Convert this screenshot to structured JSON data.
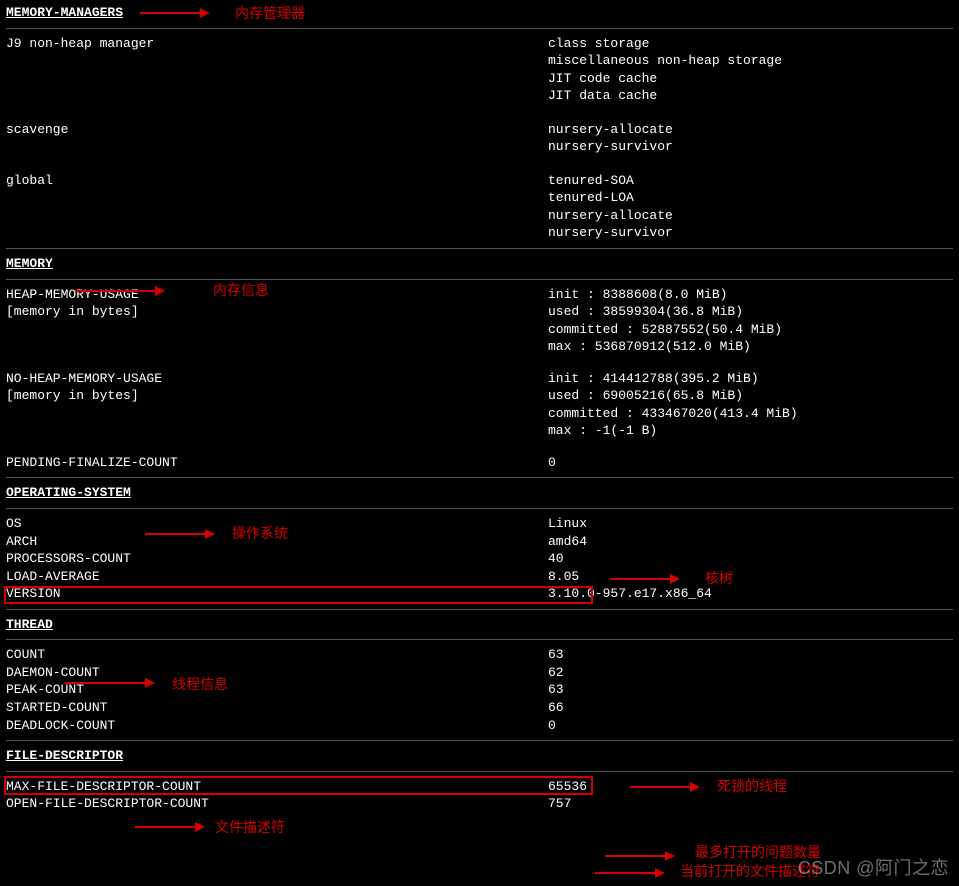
{
  "memory_managers": {
    "header": "MEMORY-MANAGERS",
    "anno": "内存管理器",
    "rows": [
      {
        "name": "J9 non-heap manager",
        "items": [
          "class storage",
          "miscellaneous non-heap storage",
          "JIT code cache",
          "JIT data cache"
        ]
      },
      {
        "name": "scavenge",
        "items": [
          "nursery-allocate",
          "nursery-survivor"
        ]
      },
      {
        "name": "global",
        "items": [
          "tenured-SOA",
          "tenured-LOA",
          "nursery-allocate",
          "nursery-survivor"
        ]
      }
    ]
  },
  "memory": {
    "header": "MEMORY",
    "anno": "内存信息",
    "heap": {
      "label": "HEAP-MEMORY-USAGE",
      "sub": "[memory in bytes]",
      "lines": [
        "init : 8388608(8.0 MiB)",
        "used : 38599304(36.8 MiB)",
        "committed : 52887552(50.4 MiB)",
        "max : 536870912(512.0 MiB)"
      ]
    },
    "noheap": {
      "label": "NO-HEAP-MEMORY-USAGE",
      "sub": "[memory in bytes]",
      "lines": [
        "init : 414412788(395.2 MiB)",
        "used : 69005216(65.8 MiB)",
        "committed : 433467020(413.4 MiB)",
        "max : -1(-1 B)"
      ]
    },
    "pending": {
      "label": "PENDING-FINALIZE-COUNT",
      "value": "0"
    }
  },
  "os": {
    "header": "OPERATING-SYSTEM",
    "anno": "操作系统",
    "anno_cores": "核树",
    "rows": [
      {
        "k": "OS",
        "v": "Linux"
      },
      {
        "k": "ARCH",
        "v": "amd64"
      },
      {
        "k": "PROCESSORS-COUNT",
        "v": "40"
      },
      {
        "k": "LOAD-AVERAGE",
        "v": "8.05"
      },
      {
        "k": "VERSION",
        "v": "3.10.0-957.e17.x86_64"
      }
    ]
  },
  "thread": {
    "header": "THREAD",
    "anno": "线程信息",
    "anno_deadlock": "死锁的线程",
    "rows": [
      {
        "k": "COUNT",
        "v": "63"
      },
      {
        "k": "DAEMON-COUNT",
        "v": "62"
      },
      {
        "k": "PEAK-COUNT",
        "v": "63"
      },
      {
        "k": "STARTED-COUNT",
        "v": "66"
      },
      {
        "k": "DEADLOCK-COUNT",
        "v": "0"
      }
    ]
  },
  "fd": {
    "header": "FILE-DESCRIPTOR",
    "anno": "文件描述符",
    "anno_max": "最多打开的问题数量",
    "anno_open": "当前打开的文件描述符",
    "rows": [
      {
        "k": "MAX-FILE-DESCRIPTOR-COUNT",
        "v": "65536"
      },
      {
        "k": "OPEN-FILE-DESCRIPTOR-COUNT",
        "v": "757"
      }
    ]
  },
  "watermark": "CSDN @阿门之恋"
}
